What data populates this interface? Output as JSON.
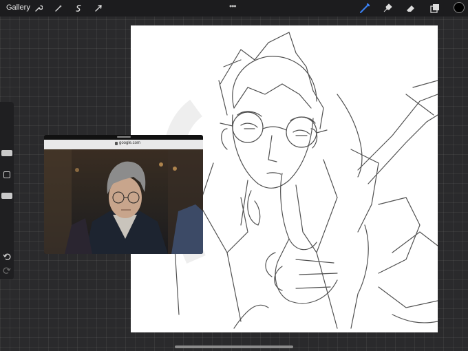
{
  "topbar": {
    "gallery_label": "Gallery",
    "tools": [
      "wrench-icon",
      "magic-wand-icon",
      "selection-icon",
      "transform-icon"
    ],
    "more_icon": "more-dots-icon",
    "right_tools": [
      "brush-icon",
      "smudge-icon",
      "eraser-icon",
      "layers-icon"
    ],
    "active_tool": "brush-icon",
    "accent_color": "#3b82f6",
    "current_color": "#000000"
  },
  "sidebar": {
    "brush_size_level": 0.3,
    "opacity_level": 0.58,
    "modify_icon": "square-icon",
    "undo_icon": "undo-icon",
    "redo_icon": "redo-icon"
  },
  "reference_window": {
    "url": "google.com"
  }
}
